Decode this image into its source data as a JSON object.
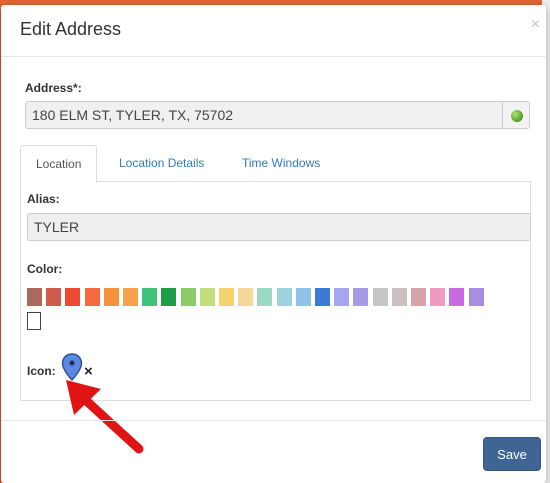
{
  "dialog": {
    "title": "Edit Address",
    "close_glyph": "×"
  },
  "address": {
    "label": "Address*:",
    "value": "180 ELM ST, TYLER, TX, 75702",
    "status_icon": "green-status-dot"
  },
  "tabs": [
    {
      "label": "Location",
      "active": true
    },
    {
      "label": "Location Details",
      "active": false
    },
    {
      "label": "Time Windows",
      "active": false
    }
  ],
  "location": {
    "alias_label": "Alias:",
    "alias_value": "TYLER",
    "color_label": "Color:",
    "colors": [
      "#a9695c",
      "#cf5b4c",
      "#ec4b32",
      "#f46a3e",
      "#f7913b",
      "#f3a24a",
      "#3fc27a",
      "#1e9c46",
      "#8ccc67",
      "#c1df7a",
      "#f4d26e",
      "#f5d99a",
      "#9ad9c4",
      "#9fd2df",
      "#93c1e7",
      "#3b79d4",
      "#a7a4f1",
      "#a89be6",
      "#c6c6c6",
      "#cbc0c0",
      "#d6a3a8",
      "#ef9bc0",
      "#c96be0",
      "#a98ddf"
    ],
    "icon_label": "Icon:",
    "icon": "map-pin-icon",
    "remove_icon": "×"
  },
  "footer": {
    "save_label": "Save"
  }
}
